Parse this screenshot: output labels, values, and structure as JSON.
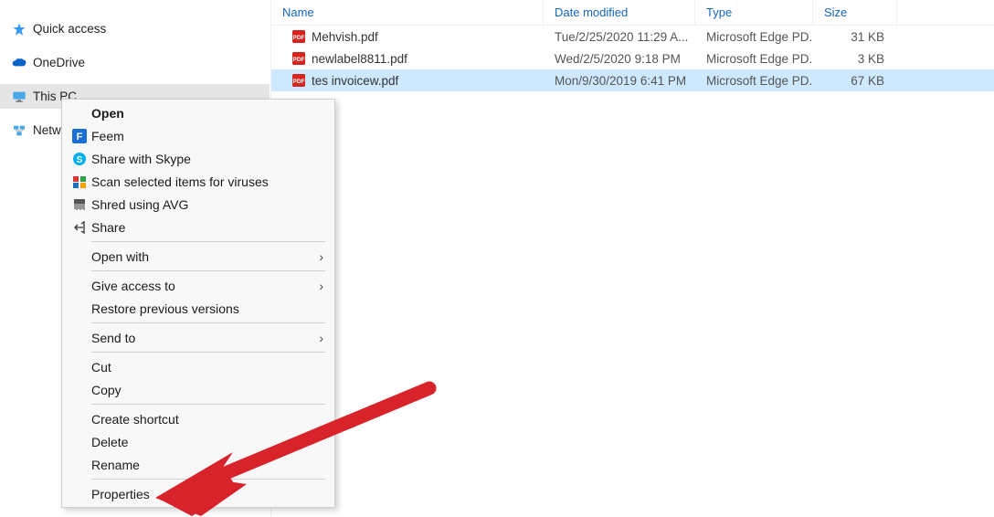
{
  "sidebar": {
    "quick_access": "Quick access",
    "onedrive": "OneDrive",
    "this_pc": "This PC",
    "network": "Netw"
  },
  "columns": {
    "name": "Name",
    "date": "Date modified",
    "type": "Type",
    "size": "Size"
  },
  "files": [
    {
      "name": "Mehvish.pdf",
      "date": "Tue/2/25/2020 11:29 A...",
      "type": "Microsoft Edge PD...",
      "size": "31 KB",
      "selected": false
    },
    {
      "name": "newlabel8811.pdf",
      "date": "Wed/2/5/2020 9:18 PM",
      "type": "Microsoft Edge PD...",
      "size": "3 KB",
      "selected": false
    },
    {
      "name": "tes invoicew.pdf",
      "date": "Mon/9/30/2019 6:41 PM",
      "type": "Microsoft Edge PD...",
      "size": "67 KB",
      "selected": true
    }
  ],
  "context_menu": {
    "open": "Open",
    "feem": "Feem",
    "skype": "Share with Skype",
    "scan": "Scan selected items for viruses",
    "shred": "Shred using AVG",
    "share": "Share",
    "open_with": "Open with",
    "give_access": "Give access to",
    "restore": "Restore previous versions",
    "send_to": "Send to",
    "cut": "Cut",
    "copy": "Copy",
    "shortcut": "Create shortcut",
    "delete": "Delete",
    "rename": "Rename",
    "properties": "Properties"
  }
}
